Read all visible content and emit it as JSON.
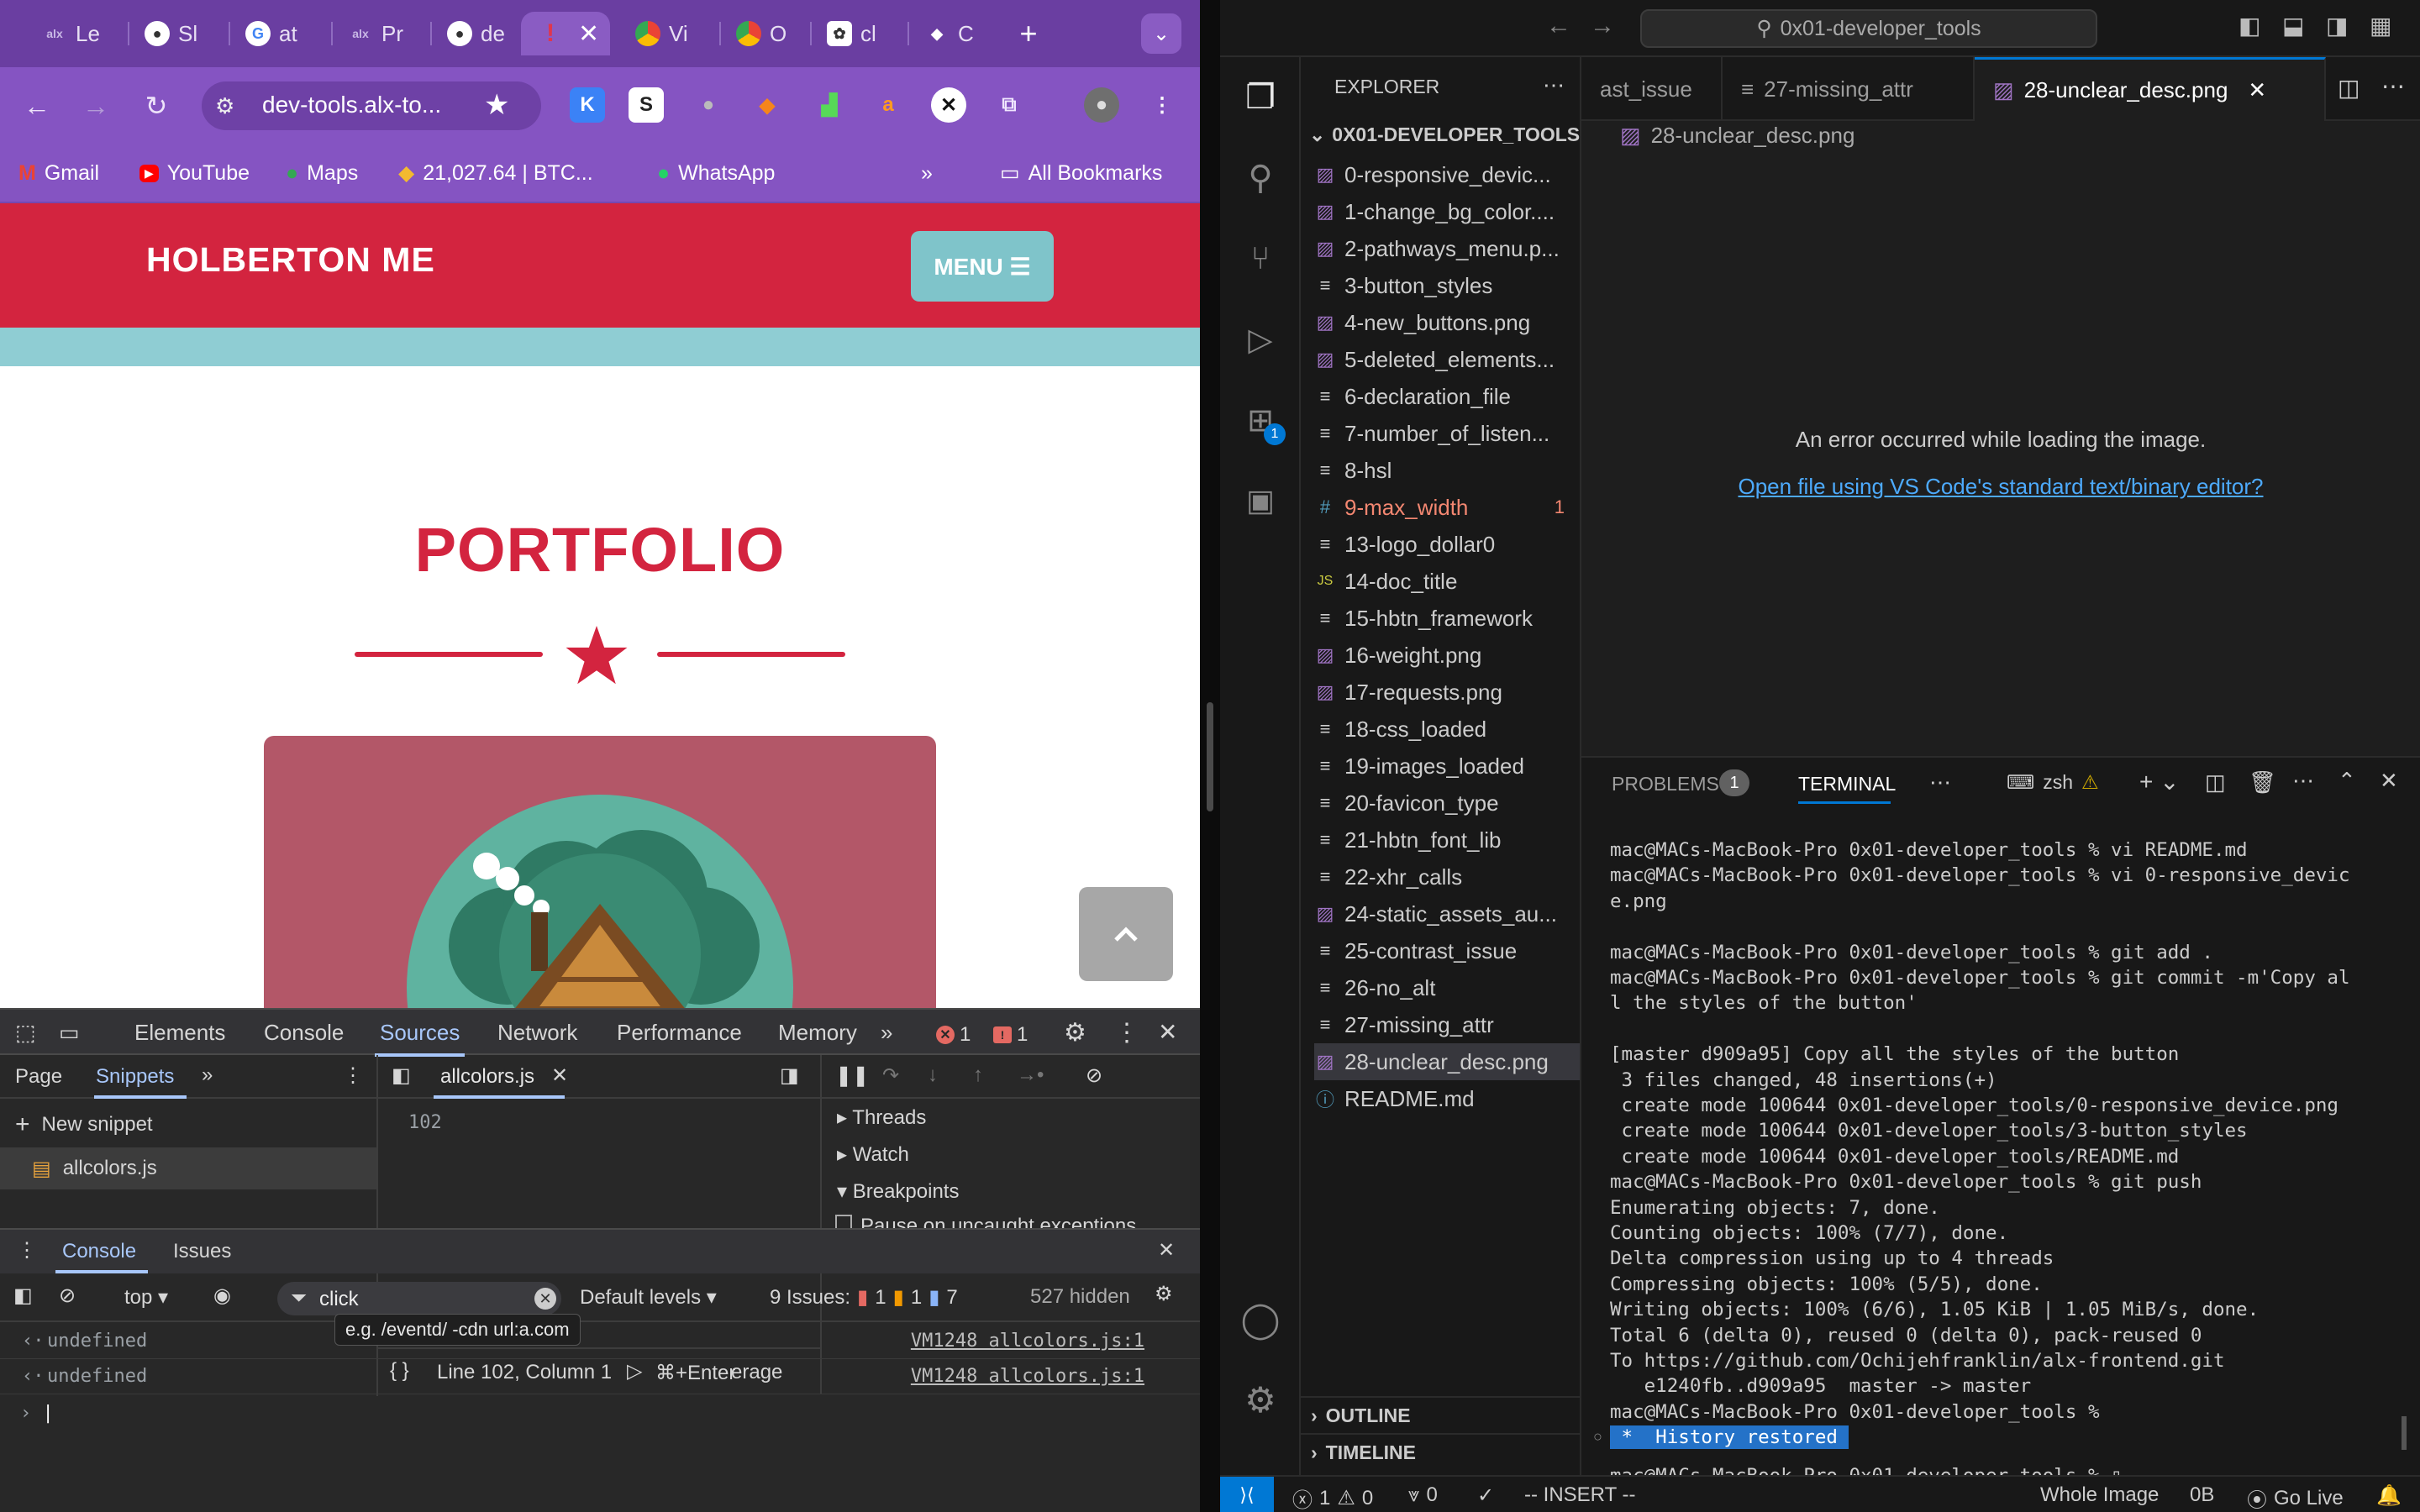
{
  "browser": {
    "tabs": [
      {
        "label": "Le",
        "icon": "alx-icon"
      },
      {
        "label": "Sl",
        "icon": "github-icon"
      },
      {
        "label": "at",
        "icon": "google-icon"
      },
      {
        "label": "Pr",
        "icon": "alx-icon"
      },
      {
        "label": "de",
        "icon": "github-icon"
      },
      {
        "label": "",
        "icon": "holberton-icon",
        "active": true
      },
      {
        "label": "Vi",
        "icon": "chrome-icon"
      },
      {
        "label": "O",
        "icon": "chrome-icon"
      },
      {
        "label": "cl",
        "icon": "openai-icon"
      },
      {
        "label": "C",
        "icon": "gemini-icon"
      }
    ],
    "url": "dev-tools.alx-to...",
    "bookmarks": [
      {
        "label": "Gmail",
        "icon": "gmail-icon"
      },
      {
        "label": "YouTube",
        "icon": "youtube-icon"
      },
      {
        "label": "Maps",
        "icon": "maps-icon"
      },
      {
        "label": "21,027.64  |  BTC...",
        "icon": "binance-icon"
      },
      {
        "label": "WhatsApp",
        "icon": "whatsapp-icon"
      }
    ],
    "all_bookmarks": "All Bookmarks"
  },
  "site": {
    "logo": "HOLBERTON ME",
    "menu_label": "MENU ☰",
    "section_title": "PORTFOLIO",
    "colors": {
      "primary": "#d3243f",
      "teal": "#8fcdd3",
      "card": "#b35768"
    }
  },
  "devtools": {
    "tabs": [
      "Elements",
      "Console",
      "Sources",
      "Network",
      "Performance",
      "Memory"
    ],
    "active_tab": "Sources",
    "error_count": "1",
    "issue_count": "1",
    "nav_tabs": {
      "page": "Page",
      "snippets": "Snippets"
    },
    "new_snippet": "New snippet",
    "snippet_file": "allcolors.js",
    "editor_tab": "allcolors.js",
    "line_number": "102",
    "cursor_status": "Line 102, Column 1",
    "run_hint": "⌘+Enter",
    "run_hint_suffix": "erage",
    "debug_sections": [
      "Threads",
      "Watch",
      "Breakpoints"
    ],
    "pause_label": "Pause on uncaught exceptions",
    "drawer_tabs": [
      "Console",
      "Issues"
    ],
    "context": "top",
    "filter_value": "click",
    "filter_tooltip": "e.g. /eventd/ -cdn url:a.com",
    "levels": "Default levels",
    "issues_label": "9 Issues:",
    "issues_counts": [
      "1",
      "1",
      "7"
    ],
    "hidden": "527 hidden",
    "logs": [
      {
        "text": "undefined",
        "source": "VM1248 allcolors.js:1"
      },
      {
        "text": "undefined",
        "source": "VM1248 allcolors.js:1"
      }
    ]
  },
  "vscode": {
    "search": "0x01-developer_tools",
    "explorer_title": "EXPLORER",
    "folder": "0X01-DEVELOPER_TOOLS",
    "files": [
      {
        "name": "0-responsive_devic...",
        "type": "image"
      },
      {
        "name": "1-change_bg_color....",
        "type": "image"
      },
      {
        "name": "2-pathways_menu.p...",
        "type": "image"
      },
      {
        "name": "3-button_styles",
        "type": "text"
      },
      {
        "name": "4-new_buttons.png",
        "type": "image"
      },
      {
        "name": "5-deleted_elements...",
        "type": "image"
      },
      {
        "name": "6-declaration_file",
        "type": "text"
      },
      {
        "name": "7-number_of_listen...",
        "type": "text"
      },
      {
        "name": "8-hsl",
        "type": "text"
      },
      {
        "name": "9-max_width",
        "type": "css",
        "problems": "1"
      },
      {
        "name": "13-logo_dollar0",
        "type": "text"
      },
      {
        "name": "14-doc_title",
        "type": "js"
      },
      {
        "name": "15-hbtn_framework",
        "type": "text"
      },
      {
        "name": "16-weight.png",
        "type": "image"
      },
      {
        "name": "17-requests.png",
        "type": "image"
      },
      {
        "name": "18-css_loaded",
        "type": "text"
      },
      {
        "name": "19-images_loaded",
        "type": "text"
      },
      {
        "name": "20-favicon_type",
        "type": "text"
      },
      {
        "name": "21-hbtn_font_lib",
        "type": "text"
      },
      {
        "name": "22-xhr_calls",
        "type": "text"
      },
      {
        "name": "24-static_assets_au...",
        "type": "image"
      },
      {
        "name": "25-contrast_issue",
        "type": "text"
      },
      {
        "name": "26-no_alt",
        "type": "text"
      },
      {
        "name": "27-missing_attr",
        "type": "text"
      },
      {
        "name": "28-unclear_desc.png",
        "type": "image",
        "selected": true
      },
      {
        "name": "README.md",
        "type": "info"
      }
    ],
    "outline": "OUTLINE",
    "timeline": "TIMELINE",
    "editor_tabs": [
      "ast_issue",
      "27-missing_attr",
      "28-unclear_desc.png"
    ],
    "breadcrumb": "28-unclear_desc.png",
    "error_message": "An error occurred while loading the image.",
    "open_link": "Open file using VS Code's standard text/binary editor?",
    "panel_tabs": {
      "problems": "PROBLEMS",
      "problems_count": "1",
      "terminal": "TERMINAL"
    },
    "shell": "zsh",
    "terminal_lines": [
      "mac@MACs-MacBook-Pro 0x01-developer_tools % vi README.md",
      "mac@MACs-MacBook-Pro 0x01-developer_tools % vi 0-responsive_devic",
      "e.png",
      "",
      "mac@MACs-MacBook-Pro 0x01-developer_tools % git add .",
      "mac@MACs-MacBook-Pro 0x01-developer_tools % git commit -m'Copy al",
      "l the styles of the button'",
      "",
      "[master d909a95] Copy all the styles of the button",
      " 3 files changed, 48 insertions(+)",
      " create mode 100644 0x01-developer_tools/0-responsive_device.png",
      " create mode 100644 0x01-developer_tools/3-button_styles",
      " create mode 100644 0x01-developer_tools/README.md",
      "mac@MACs-MacBook-Pro 0x01-developer_tools % git push",
      "Enumerating objects: 7, done.",
      "Counting objects: 100% (7/7), done.",
      "Delta compression using up to 4 threads",
      "Compressing objects: 100% (5/5), done.",
      "Writing objects: 100% (6/6), 1.05 KiB | 1.05 MiB/s, done.",
      "Total 6 (delta 0), reused 0 (delta 0), pack-reused 0",
      "To https://github.com/Ochijehfranklin/alx-frontend.git",
      "   e1240fb..d909a95  master -> master",
      "mac@MACs-MacBook-Pro 0x01-developer_tools %"
    ],
    "history_restored": " *  History restored ",
    "prompt": "mac@MACs-MacBook-Pro 0x01-developer_tools % ",
    "status": {
      "errors": "1",
      "warnings": "0",
      "ports": "0",
      "mode": "-- INSERT --",
      "whole_image": "Whole Image",
      "size": "0B",
      "go_live": "Go Live"
    },
    "accent": "#0078d4"
  }
}
